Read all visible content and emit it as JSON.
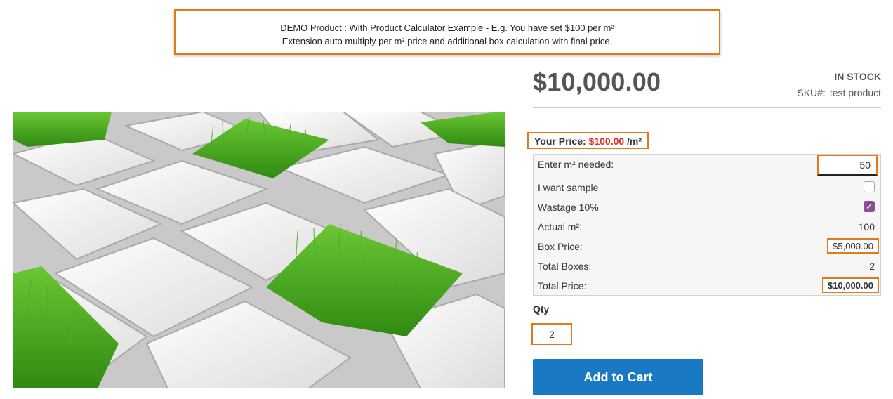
{
  "demo_note": {
    "line1": "DEMO Product : With Product Calculator Example - E.g. You have set $100 per m²",
    "line2": "Extension auto multiply per m² price and additional box calculation with final price."
  },
  "product": {
    "price": "$10,000.00",
    "stock": "IN STOCK",
    "sku_label": "SKU#:",
    "sku_value": "test product"
  },
  "your_price": {
    "label": "Your Price:",
    "amount": "$100.00",
    "unit": "/m²"
  },
  "calculator": {
    "m2_label": "Enter m² needed:",
    "m2_value": "50",
    "sample_label": "I want sample",
    "sample_checked": false,
    "wastage_label": "Wastage 10%",
    "wastage_checked": true,
    "actual_label": "Actual m²:",
    "actual_value": "100",
    "box_price_label": "Box Price:",
    "box_price_value": "$5,000.00",
    "total_boxes_label": "Total Boxes:",
    "total_boxes_value": "2",
    "total_price_label": "Total Price:",
    "total_price_value": "$10,000.00"
  },
  "qty": {
    "label": "Qty",
    "value": "2"
  },
  "cart": {
    "button_label": "Add to Cart"
  },
  "colors": {
    "accent_orange": "#e07b1a",
    "price_red": "#e02b27",
    "button_blue": "#1979c3",
    "checkbox_purple": "#8a4f93"
  }
}
